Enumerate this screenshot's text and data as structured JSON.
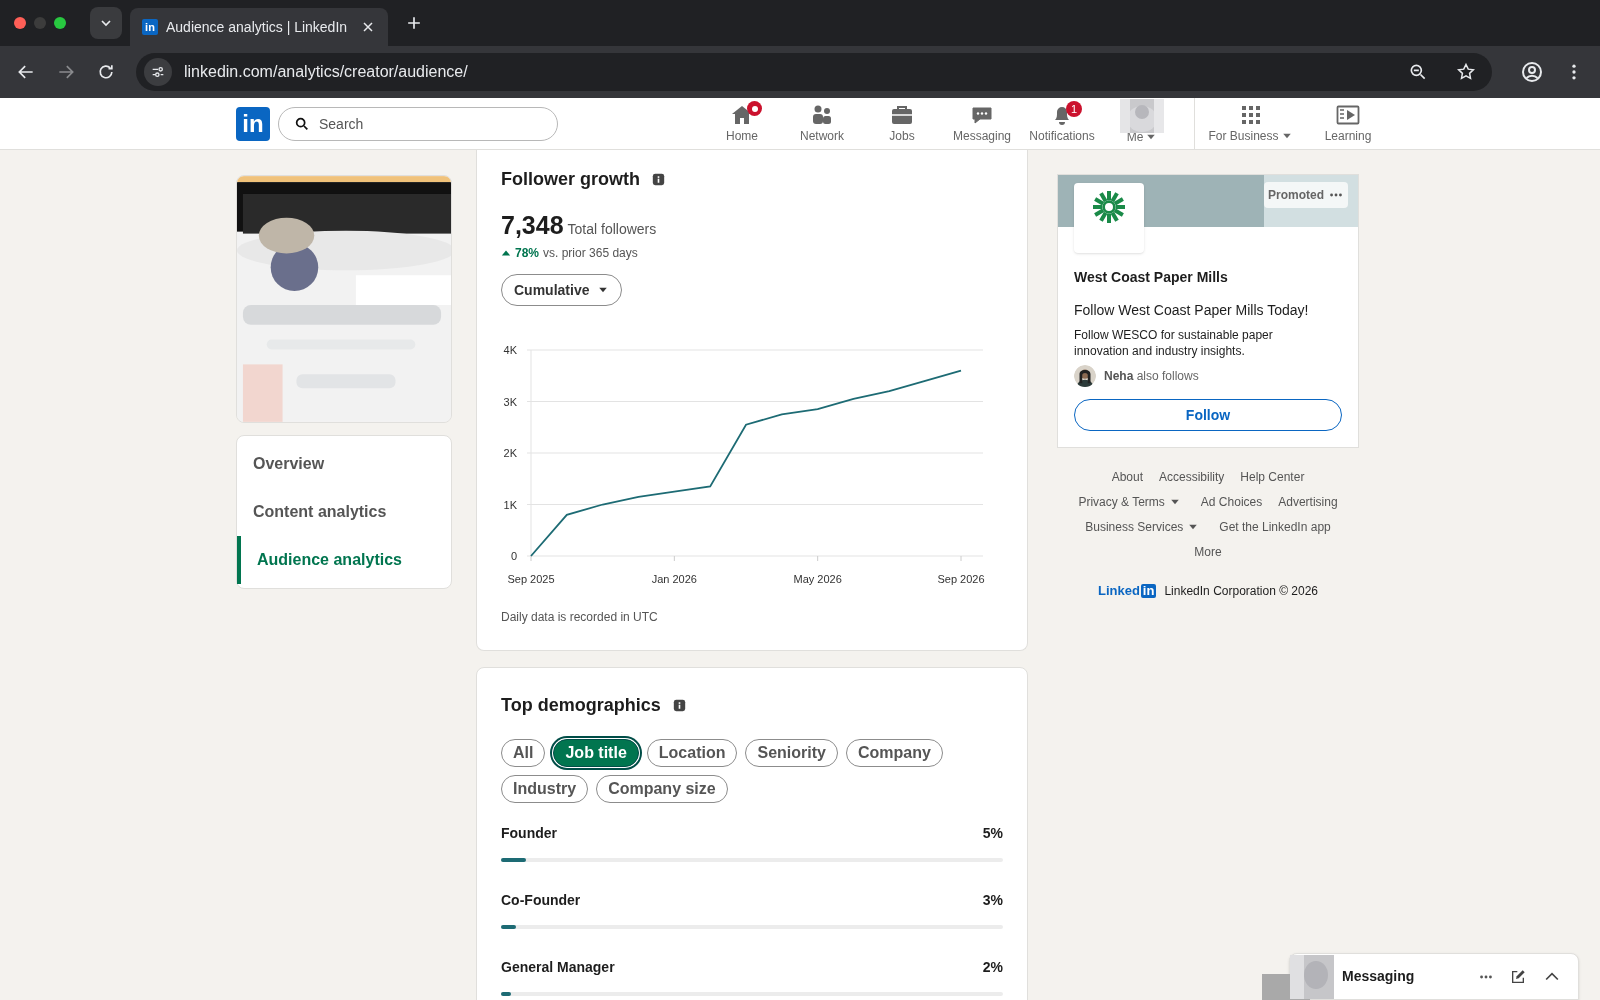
{
  "browser": {
    "favicon_text": "in",
    "tab_title": "Audience analytics | LinkedIn",
    "url": "linkedin.com/analytics/creator/audience/"
  },
  "nav": {
    "logo_text": "in",
    "search_placeholder": "Search",
    "items": [
      {
        "kind": "home",
        "label": "Home",
        "dot": true
      },
      {
        "kind": "network",
        "label": "Network"
      },
      {
        "kind": "jobs",
        "label": "Jobs"
      },
      {
        "kind": "messaging",
        "label": "Messaging"
      },
      {
        "kind": "bell",
        "label": "Notifications",
        "badge": "1"
      },
      {
        "kind": "me",
        "label": "Me"
      },
      {
        "kind": "grid",
        "label": "For Business"
      },
      {
        "kind": "video",
        "label": "Learning"
      }
    ]
  },
  "sidebar": {
    "items": [
      {
        "label": "Overview",
        "selected": false
      },
      {
        "label": "Content analytics",
        "selected": false
      },
      {
        "label": "Audience analytics",
        "selected": true
      }
    ]
  },
  "follower_growth": {
    "title": "Follower growth",
    "total": "7,348",
    "total_label": "Total followers",
    "change": "78%",
    "change_label": "vs. prior 365 days",
    "dropdown": "Cumulative",
    "note": "Daily data is recorded in UTC",
    "chart_data": {
      "type": "line",
      "categories": [
        "Sep 2025",
        null,
        null,
        null,
        "Jan 2026",
        null,
        null,
        null,
        "May 2026",
        null,
        null,
        null,
        "Sep 2026"
      ],
      "series": [
        {
          "color": "#1d6b74",
          "values": [
            0,
            800,
            1000,
            1150,
            1250,
            1350,
            2550,
            2750,
            2850,
            3050,
            3200,
            3400,
            3600
          ]
        }
      ],
      "ylim": [
        0,
        4000
      ],
      "grid": true,
      "yticks": [
        {
          "value": 0,
          "label": "0"
        },
        {
          "value": 1000,
          "label": "1K"
        },
        {
          "value": 2000,
          "label": "2K"
        },
        {
          "value": 3000,
          "label": "3K"
        },
        {
          "value": 4000,
          "label": "4K"
        }
      ]
    }
  },
  "demographics": {
    "title": "Top demographics",
    "filters": [
      {
        "label": "All",
        "selected": false
      },
      {
        "label": "Job title",
        "selected": true
      },
      {
        "label": "Location",
        "selected": false
      },
      {
        "label": "Seniority",
        "selected": false
      },
      {
        "label": "Company",
        "selected": false
      },
      {
        "label": "Industry",
        "selected": false
      },
      {
        "label": "Company size",
        "selected": false
      }
    ],
    "rows": [
      {
        "label": "Founder",
        "value": "5%",
        "level": 0.05
      },
      {
        "label": "Co-Founder",
        "value": "3%",
        "level": 0.03
      },
      {
        "label": "General Manager",
        "value": "2%",
        "level": 0.02
      }
    ]
  },
  "ad": {
    "badge": "Promoted",
    "company": "West Coast Paper Mills",
    "headline": "Follow West Coast Paper Mills Today!",
    "body": "Follow WESCO for sustainable paper innovation and industry insights.",
    "social_name": "Neha",
    "social_text": "also follows",
    "button": "Follow"
  },
  "footer": {
    "links": [
      {
        "label": "About",
        "caret": false
      },
      {
        "label": "Accessibility",
        "caret": false
      },
      {
        "label": "Help Center",
        "caret": false
      },
      {
        "label": "Privacy & Terms",
        "caret": true
      },
      {
        "label": "Ad Choices",
        "caret": false
      },
      {
        "label": "Advertising",
        "caret": false
      },
      {
        "label": "Business Services",
        "caret": true
      },
      {
        "label": "Get the LinkedIn app",
        "caret": false
      },
      {
        "label": "More",
        "caret": false
      }
    ],
    "brand": "Linked",
    "brand_in": "in",
    "copyright": "LinkedIn Corporation © 2026"
  },
  "messaging": {
    "title": "Messaging"
  }
}
